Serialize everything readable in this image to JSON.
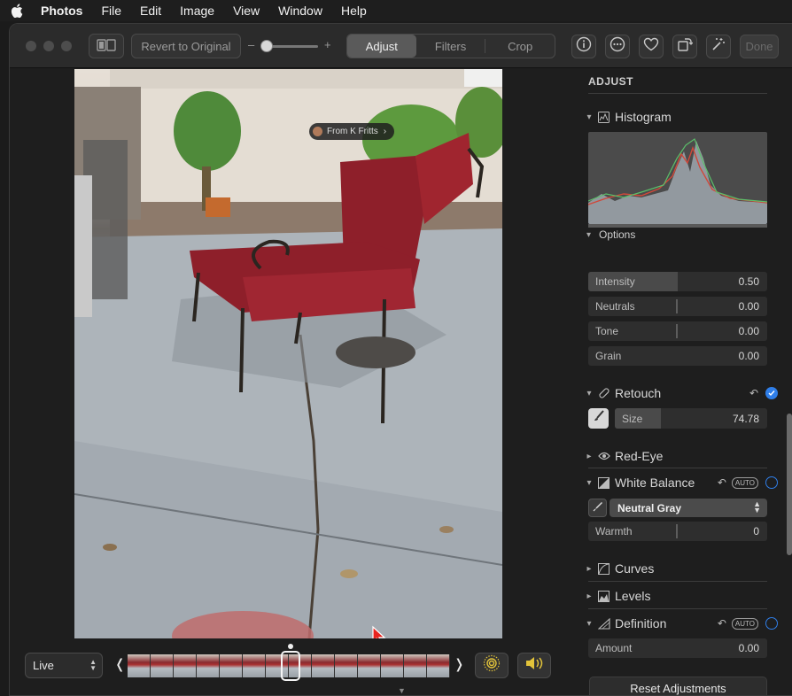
{
  "menubar": {
    "items": [
      "Photos",
      "File",
      "Edit",
      "Image",
      "View",
      "Window",
      "Help"
    ]
  },
  "toolbar": {
    "revert_label": "Revert to Original",
    "zoom_minus": "–",
    "zoom_plus": "+",
    "tabs": [
      "Adjust",
      "Filters",
      "Crop"
    ],
    "active_tab": "Adjust",
    "done_label": "Done"
  },
  "photo": {
    "from_badge": "From K Fritts",
    "from_chevron": "›"
  },
  "bottom": {
    "live_label": "Live",
    "prev_glyph": "❬",
    "next_glyph": "❭"
  },
  "sidebar": {
    "title": "ADJUST",
    "histogram_label": "Histogram",
    "options_label": "Options",
    "options": [
      {
        "label": "Intensity",
        "value": "0.50",
        "level": 0.5
      },
      {
        "label": "Neutrals",
        "value": "0.00",
        "level": 0
      },
      {
        "label": "Tone",
        "value": "0.00",
        "level": 0
      },
      {
        "label": "Grain",
        "value": "0.00",
        "level": 0
      }
    ],
    "retouch": {
      "label": "Retouch",
      "size_label": "Size",
      "size_value": "74.78",
      "size_level": 0.3
    },
    "red_eye_label": "Red-Eye",
    "white_balance": {
      "label": "White Balance",
      "auto": "AUTO",
      "mode": "Neutral Gray",
      "warmth_label": "Warmth",
      "warmth_value": "0"
    },
    "curves_label": "Curves",
    "levels_label": "Levels",
    "definition": {
      "label": "Definition",
      "auto": "AUTO",
      "amount_label": "Amount",
      "amount_value": "0.00"
    },
    "reset_label": "Reset Adjustments"
  },
  "colors": {
    "accent": "#2f7ee8",
    "chair_red": "#8e1f2a",
    "histogram_bg": "#4b4b4b"
  },
  "icons": [
    "apple-icon",
    "sidebar-toggle-icon",
    "info-icon",
    "more-icon",
    "heart-icon",
    "rotate-icon",
    "magic-wand-icon",
    "histogram-icon",
    "bandage-icon",
    "eye-icon",
    "white-balance-icon",
    "curves-icon",
    "levels-icon",
    "definition-icon",
    "undo-icon",
    "brush-icon",
    "eyedropper-icon",
    "live-photo-icon",
    "speaker-icon"
  ]
}
